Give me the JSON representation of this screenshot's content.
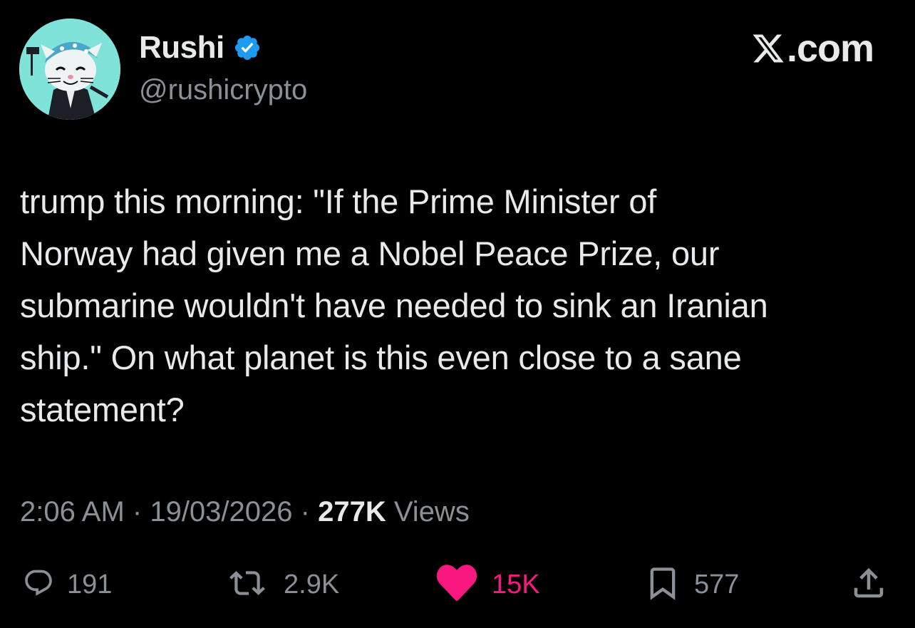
{
  "author": {
    "display_name": "Rushi",
    "handle": "@rushicrypto",
    "verified": true,
    "verified_color": "#1d9bf0",
    "avatar_icon": "cartoon-cat-avatar"
  },
  "brand": {
    "text": ".com",
    "icon": "x-logo-icon"
  },
  "tweet": {
    "text": "trump this morning: \"If the Prime Minister of\nNorway had given me a Nobel Peace Prize, our\nsubmarine wouldn't have needed to sink an Iranian\nship.\" On what planet is this even close to a sane\nstatement?"
  },
  "meta": {
    "time": "2:06 AM",
    "separator": "·",
    "date": "19/03/2026",
    "views_count": "277K",
    "views_label": "Views"
  },
  "actions": {
    "replies": "191",
    "reposts": "2.9K",
    "likes": "15K",
    "bookmarks": "577"
  },
  "colors": {
    "background": "#000000",
    "text": "#e7e9ea",
    "muted": "#8b9097",
    "like": "#f91880"
  }
}
